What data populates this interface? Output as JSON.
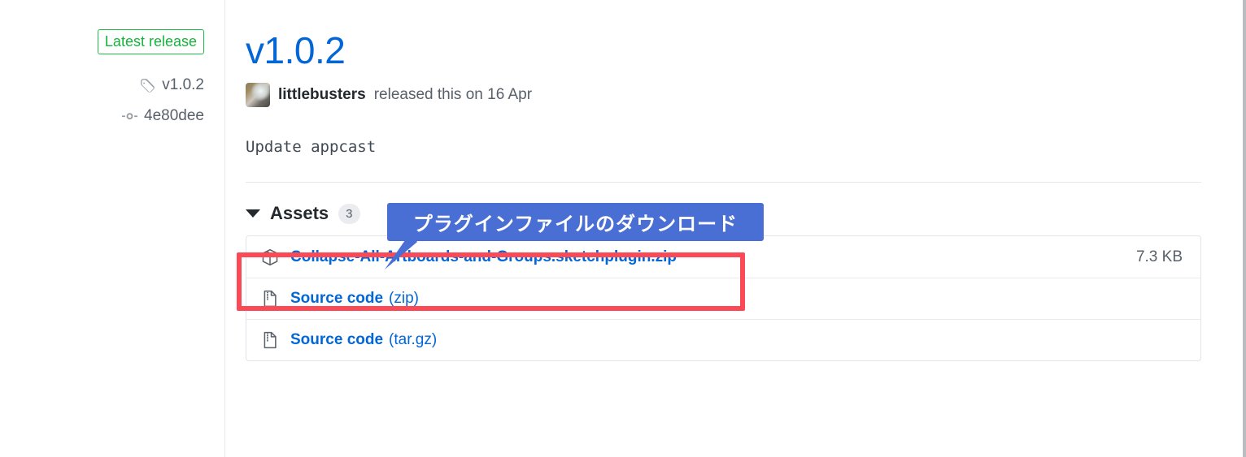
{
  "sidebar": {
    "latest_release_badge": "Latest release",
    "tag": {
      "icon": "tag-icon",
      "label": "v1.0.2"
    },
    "commit": {
      "icon": "commit-icon",
      "label": "4e80dee"
    }
  },
  "main": {
    "release_title": "v1.0.2",
    "author": {
      "avatar": "user-avatar",
      "name": "littlebusters",
      "released_text": "released this on 16 Apr"
    },
    "body": "Update appcast",
    "assets": {
      "caret": "chevron-down-icon",
      "label": "Assets",
      "count": "3",
      "rows": [
        {
          "icon": "package-icon",
          "name": "Collapse-All-Artboards-and-Groups.sketchplugin.zip",
          "ext": "",
          "size": "7.3 KB"
        },
        {
          "icon": "file-zip-icon",
          "name": "Source code",
          "ext": "(zip)",
          "size": ""
        },
        {
          "icon": "file-zip-icon",
          "name": "Source code",
          "ext": "(tar.gz)",
          "size": ""
        }
      ]
    }
  },
  "annotations": {
    "callout": {
      "text": "プラグインファイルのダウンロード",
      "color": "#4a6fd4"
    },
    "highlight": {
      "color": "#fb4a55"
    }
  }
}
